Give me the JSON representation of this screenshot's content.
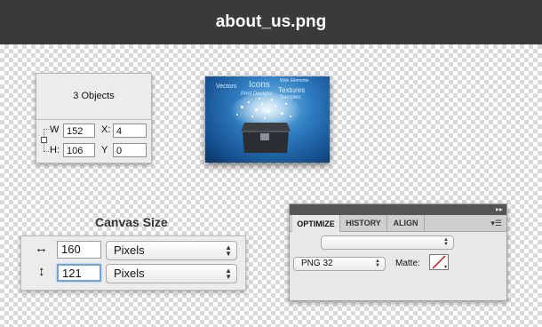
{
  "window": {
    "title": "about_us.png"
  },
  "objects_panel": {
    "title": "3 Objects",
    "w_label": "W",
    "w_value": "152",
    "h_label": "H:",
    "h_value": "106",
    "x_label": "X:",
    "x_value": "4",
    "y_label": "Y",
    "y_value": "0"
  },
  "preview": {
    "words": [
      "Vectors",
      "Icons",
      "Web Elements",
      "Print Designs",
      "Textures",
      "Samples"
    ]
  },
  "canvas_size": {
    "heading": "Canvas Size",
    "width_value": "160",
    "height_value": "121",
    "width_unit": "Pixels",
    "height_unit": "Pixels",
    "width_icon": "horizontal-resize-icon",
    "height_icon": "vertical-resize-icon"
  },
  "optimize_panel": {
    "tabs": [
      "OPTIMIZE",
      "HISTORY",
      "ALIGN"
    ],
    "active_tab": "OPTIMIZE",
    "preset_value": "",
    "format_value": "PNG 32",
    "matte_label": "Matte:",
    "matte_color": "none"
  },
  "colors": {
    "titlebar": "#3a3a3a",
    "focus_ring": "#6fa3dc",
    "matte_slash": "#cc1111"
  }
}
